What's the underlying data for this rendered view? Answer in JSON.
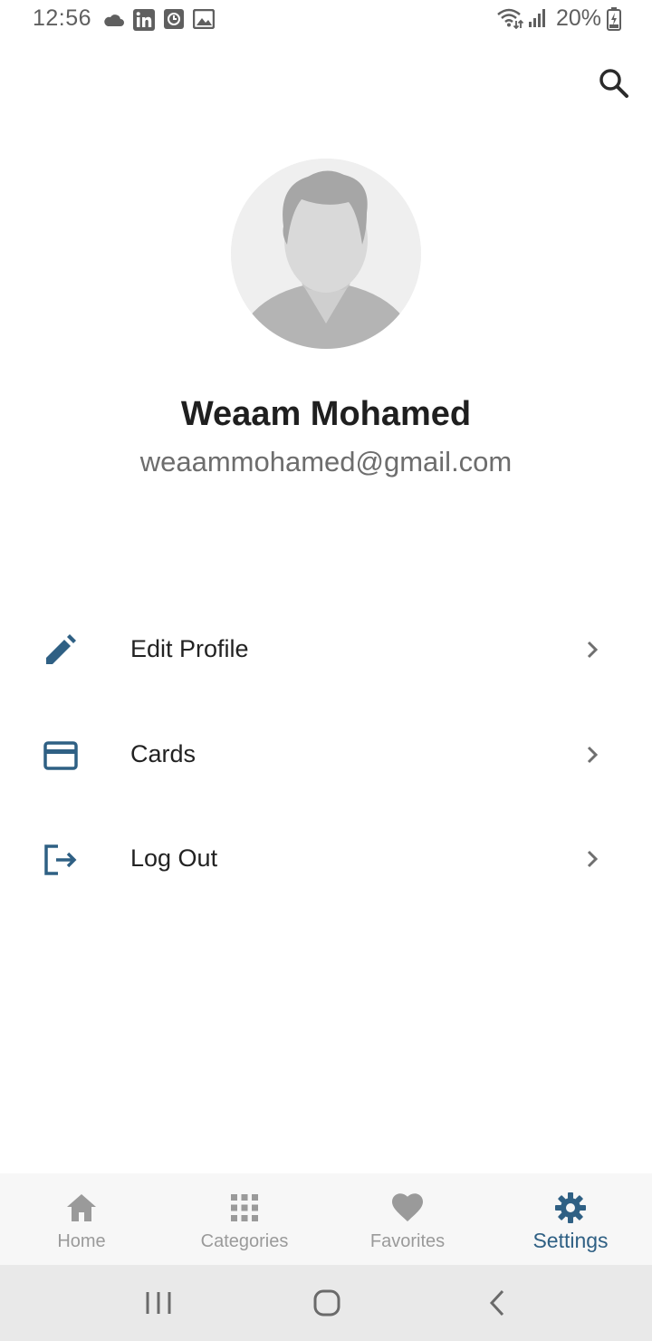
{
  "status_bar": {
    "time": "12:56",
    "battery": "20%",
    "icons": [
      "cloud-icon",
      "linkedin-icon",
      "clock-app-icon",
      "gallery-icon",
      "wifi-icon",
      "signal-icon",
      "battery-icon"
    ]
  },
  "app_bar": {
    "search_icon": "search-icon"
  },
  "profile": {
    "name": "Weaam Mohamed",
    "email": "weaammohamed@gmail.com"
  },
  "menu": {
    "items": [
      {
        "label": "Edit Profile",
        "icon": "pencil-icon"
      },
      {
        "label": "Cards",
        "icon": "credit-card-icon"
      },
      {
        "label": "Log Out",
        "icon": "logout-icon"
      }
    ]
  },
  "bottom_nav": {
    "items": [
      {
        "label": "Home",
        "icon": "home-icon"
      },
      {
        "label": "Categories",
        "icon": "grid-icon"
      },
      {
        "label": "Favorites",
        "icon": "heart-icon"
      },
      {
        "label": "Settings",
        "icon": "gear-icon"
      }
    ],
    "active": "Settings"
  },
  "colors": {
    "accent": "#2f6084",
    "inactive": "#9a9a9a",
    "nav_background": "#f7f7f7"
  }
}
